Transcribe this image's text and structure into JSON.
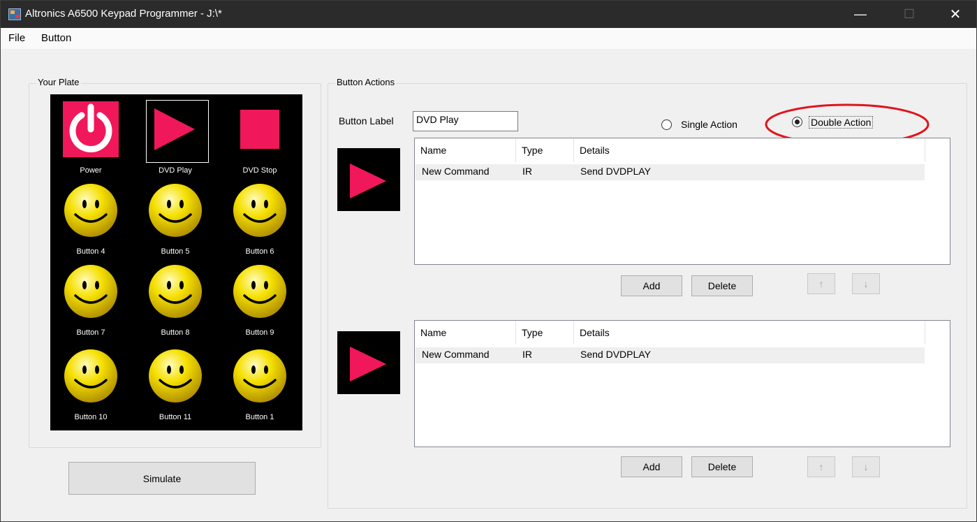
{
  "window": {
    "title": "Altronics A6500 Keypad Programmer - J:\\*",
    "controls": {
      "minimize": "—",
      "maximize": "☐",
      "close": "✕"
    }
  },
  "menu": {
    "items": [
      "File",
      "Button"
    ]
  },
  "plate_group": {
    "label": "Your Plate",
    "buttons": [
      {
        "label": "Power",
        "icon": "power-icon"
      },
      {
        "label": "DVD Play",
        "icon": "play-icon",
        "selected": true
      },
      {
        "label": "DVD Stop",
        "icon": "stop-icon"
      },
      {
        "label": "Button 4",
        "icon": "smiley-icon"
      },
      {
        "label": "Button 5",
        "icon": "smiley-icon"
      },
      {
        "label": "Button 6",
        "icon": "smiley-icon"
      },
      {
        "label": "Button 7",
        "icon": "smiley-icon"
      },
      {
        "label": "Button 8",
        "icon": "smiley-icon"
      },
      {
        "label": "Button 9",
        "icon": "smiley-icon"
      },
      {
        "label": "Button 10",
        "icon": "smiley-icon"
      },
      {
        "label": "Button 11",
        "icon": "smiley-icon"
      },
      {
        "label": "Button 1",
        "icon": "smiley-icon"
      }
    ],
    "simulate_label": "Simulate"
  },
  "actions_group": {
    "label": "Button Actions",
    "button_label_caption": "Button Label",
    "button_label_value": "DVD Play",
    "single_action": {
      "label": "Single Action",
      "checked": false
    },
    "double_action": {
      "label": "Double Action",
      "checked": true
    },
    "columns": [
      "Name",
      "Type",
      "Details"
    ],
    "lists": [
      {
        "rows": [
          {
            "name": "New Command",
            "type": "IR",
            "details": "Send DVDPLAY"
          }
        ]
      },
      {
        "rows": [
          {
            "name": "New Command",
            "type": "IR",
            "details": "Send DVDPLAY"
          }
        ]
      }
    ],
    "add_label": "Add",
    "delete_label": "Delete",
    "up_label": "↑",
    "down_label": "↓"
  },
  "colors": {
    "accent_red": "#f0185a",
    "highlight_ellipse": "#e0141e",
    "smiley_yellow": "#f5e000",
    "titlebar": "#2b2b2b"
  }
}
